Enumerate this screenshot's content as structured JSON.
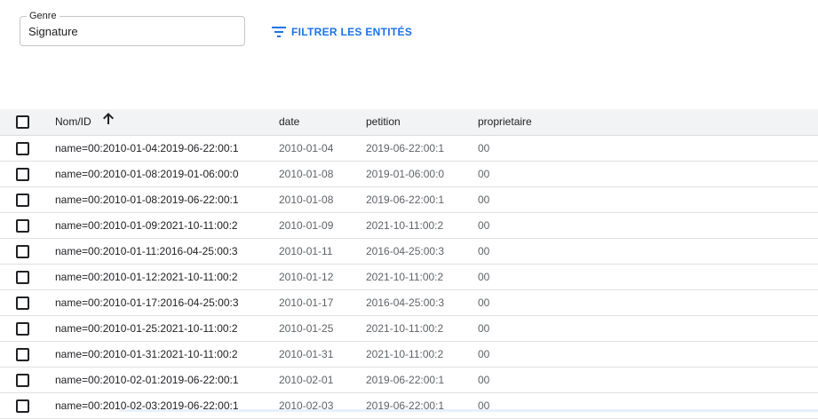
{
  "filter_bar": {
    "kind_label": "Genre",
    "kind_value": "Signature",
    "filter_button_label": "FILTRER LES ENTITÉS",
    "accent_color": "#1a73e8"
  },
  "table": {
    "headers": {
      "name": "Nom/ID",
      "date": "date",
      "petition": "petition",
      "owner": "proprietaire"
    },
    "sort": {
      "column": "Nom/ID",
      "direction": "ascending",
      "icon": "arrow-up-icon"
    },
    "rows": [
      {
        "name": "name=00:2010-01-04:2019-06-22:00:1",
        "date": "2010-01-04",
        "petition": "2019-06-22:00:1",
        "owner": "00"
      },
      {
        "name": "name=00:2010-01-08:2019-01-06:00:0",
        "date": "2010-01-08",
        "petition": "2019-01-06:00:0",
        "owner": "00"
      },
      {
        "name": "name=00:2010-01-08:2019-06-22:00:1",
        "date": "2010-01-08",
        "petition": "2019-06-22:00:1",
        "owner": "00"
      },
      {
        "name": "name=00:2010-01-09:2021-10-11:00:2",
        "date": "2010-01-09",
        "petition": "2021-10-11:00:2",
        "owner": "00"
      },
      {
        "name": "name=00:2010-01-11:2016-04-25:00:3",
        "date": "2010-01-11",
        "petition": "2016-04-25:00:3",
        "owner": "00"
      },
      {
        "name": "name=00:2010-01-12:2021-10-11:00:2",
        "date": "2010-01-12",
        "petition": "2021-10-11:00:2",
        "owner": "00"
      },
      {
        "name": "name=00:2010-01-17:2016-04-25:00:3",
        "date": "2010-01-17",
        "petition": "2016-04-25:00:3",
        "owner": "00"
      },
      {
        "name": "name=00:2010-01-25:2021-10-11:00:2",
        "date": "2010-01-25",
        "petition": "2021-10-11:00:2",
        "owner": "00"
      },
      {
        "name": "name=00:2010-01-31:2021-10-11:00:2",
        "date": "2010-01-31",
        "petition": "2021-10-11:00:2",
        "owner": "00"
      },
      {
        "name": "name=00:2010-02-01:2019-06-22:00:1",
        "date": "2010-02-01",
        "petition": "2019-06-22:00:1",
        "owner": "00"
      },
      {
        "name": "name=00:2010-02-03:2019-06-22:00:1",
        "date": "2010-02-03",
        "petition": "2019-06-22:00:1",
        "owner": "00"
      }
    ]
  }
}
